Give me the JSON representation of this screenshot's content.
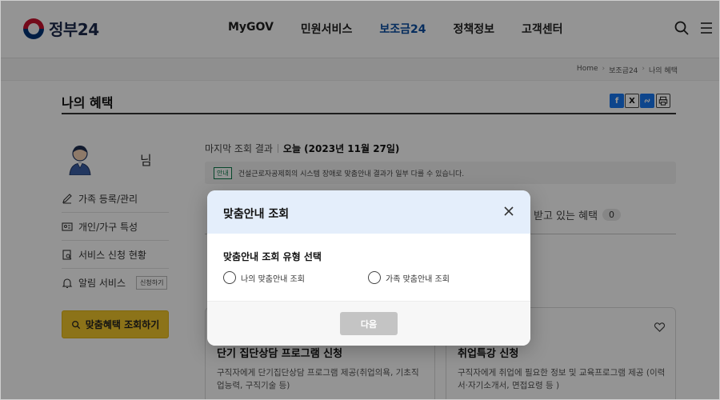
{
  "header": {
    "logo_text": "정부24",
    "nav": [
      "MyGOV",
      "민원서비스",
      "보조금24",
      "정책정보",
      "고객센터"
    ],
    "active_nav": "보조금24"
  },
  "breadcrumb": [
    "Home",
    "보조금24",
    "나의 혜택"
  ],
  "page": {
    "title": "나의 혜택",
    "share_icons": [
      "facebook-icon",
      "x-icon",
      "link-icon",
      "print-icon"
    ]
  },
  "sidebar": {
    "user_suffix": "님",
    "items": [
      {
        "label": "가족 등록/관리",
        "icon": "pencil-icon"
      },
      {
        "label": "개인/가구 특성",
        "icon": "id-card-icon"
      },
      {
        "label": "서비스 신청 현황",
        "icon": "clipboard-search-icon"
      },
      {
        "label": "알림 서비스",
        "icon": "bell-icon",
        "button": "신청하기"
      }
    ],
    "query_button": "맞춤혜택 조회하기"
  },
  "main": {
    "last_lookup_label": "마지막 조회 결과",
    "last_lookup_value": "오늘 (2023년 11월 27일)",
    "notice_tag": "안내",
    "notice_text": "건설근로자공제회의 시스템 장애로 맞춤안내 결과가 일부 다를 수 있습니다.",
    "tab_receiving_label": "받고 있는 혜택",
    "tab_receiving_count": "0",
    "cards": [
      {
        "title": "단기 집단상담 프로그램 신청",
        "desc": "구직자에게 단기집단상담 프로그램 제공(취업의욕, 기초직업능력, 구직기술 등)"
      },
      {
        "title": "취업특강 신청",
        "desc": "구직자에게 취업에 필요한 정보 및 교육프로그램 제공 (이력서·자기소개서, 면접요령 등 )"
      }
    ]
  },
  "modal": {
    "title": "맞춤안내 조회",
    "subtitle": "맞춤안내 조회 유형 선택",
    "options": [
      "나의 맞춤안내 조회",
      "가족 맞춤안내 조회"
    ],
    "next_button": "다음"
  },
  "colors": {
    "accent_blue": "#0b4fa3",
    "query_button_yellow": "#f2c62b",
    "modal_header_bg": "#e4eefb",
    "notice_green": "#0b7a4a"
  }
}
